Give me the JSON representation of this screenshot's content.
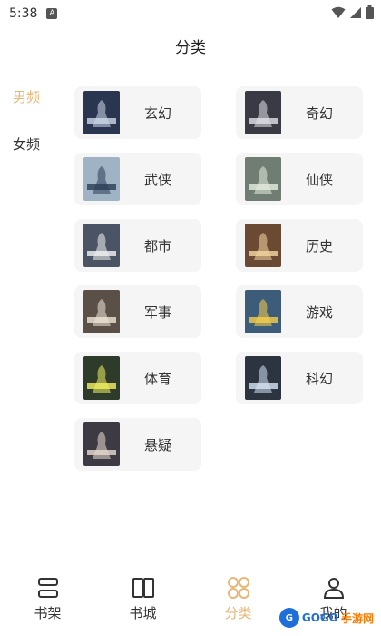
{
  "status": {
    "time": "5:38",
    "notif_letter": "A"
  },
  "header": {
    "title": "分类"
  },
  "side_nav": [
    {
      "label": "男频",
      "active": true
    },
    {
      "label": "女频",
      "active": false
    }
  ],
  "categories": [
    {
      "label": "玄幻",
      "cover_color": "#2a3550",
      "accent": "#cfd8e8"
    },
    {
      "label": "奇幻",
      "cover_color": "#3a3a44",
      "accent": "#e2e2ea"
    },
    {
      "label": "武侠",
      "cover_color": "#9fb3c4",
      "accent": "#2b3c55"
    },
    {
      "label": "仙侠",
      "cover_color": "#6f7d72",
      "accent": "#e6ecdf"
    },
    {
      "label": "都市",
      "cover_color": "#4a5464",
      "accent": "#f2f2f2"
    },
    {
      "label": "历史",
      "cover_color": "#6b4a34",
      "accent": "#f4d7a0"
    },
    {
      "label": "军事",
      "cover_color": "#5a5048",
      "accent": "#f0e6d6"
    },
    {
      "label": "游戏",
      "cover_color": "#3c5c7a",
      "accent": "#f7d04a"
    },
    {
      "label": "体育",
      "cover_color": "#2e3a2a",
      "accent": "#f2f060"
    },
    {
      "label": "科幻",
      "cover_color": "#2c3440",
      "accent": "#d6e4f4"
    },
    {
      "label": "悬疑",
      "cover_color": "#3e3a44",
      "accent": "#e8dcd0"
    }
  ],
  "bottom_nav": [
    {
      "label": "书架",
      "icon": "bookshelf-icon",
      "active": false
    },
    {
      "label": "书城",
      "icon": "bookstore-icon",
      "active": false
    },
    {
      "label": "分类",
      "icon": "category-icon",
      "active": true
    },
    {
      "label": "我的",
      "icon": "profile-icon",
      "active": false
    }
  ],
  "watermark": {
    "badge": "G",
    "part1": "GOGO",
    "part2": "手游网"
  },
  "colors": {
    "accent": "#e8b675",
    "card_bg": "#f5f5f5",
    "text": "#333333"
  }
}
